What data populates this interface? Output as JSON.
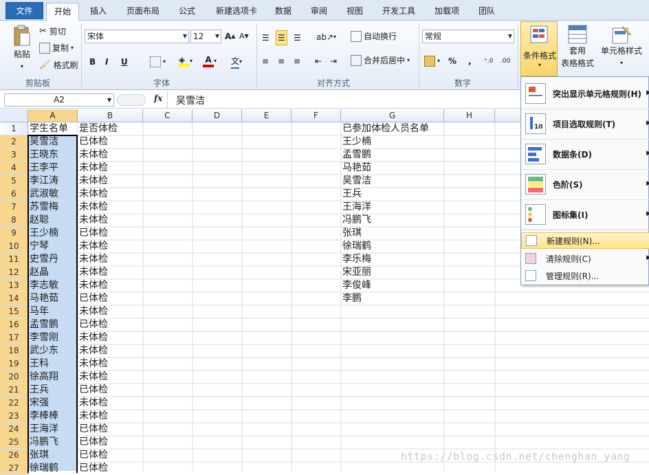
{
  "tabs": [
    {
      "label": "文件"
    },
    {
      "label": "开始"
    },
    {
      "label": "插入"
    },
    {
      "label": "页面布局"
    },
    {
      "label": "公式"
    },
    {
      "label": "新建选项卡"
    },
    {
      "label": "数据"
    },
    {
      "label": "审阅"
    },
    {
      "label": "视图"
    },
    {
      "label": "开发工具"
    },
    {
      "label": "加载项"
    },
    {
      "label": "团队"
    }
  ],
  "ribbon": {
    "paste": "粘贴",
    "cut": "剪切",
    "copy": "复制",
    "painter": "格式刷",
    "clipboard": "剪贴板",
    "font_name": "宋体",
    "font_size": "12",
    "font_group": "字体",
    "wrap": "自动换行",
    "merge": "合并后居中",
    "align_group": "对齐方式",
    "num_format": "常规",
    "number_group": "数字",
    "cond_format": "条件格式",
    "table_format_1": "套用",
    "table_format_2": "表格格式",
    "cell_style": "单元格样式",
    "bold": "B",
    "italic": "I",
    "underline": "U",
    "pct": "%",
    "comma": ","
  },
  "formula": {
    "namebox": "A2",
    "fx": "fx",
    "value": "吴雪洁"
  },
  "columns": [
    "A",
    "B",
    "C",
    "D",
    "E",
    "F",
    "G",
    "H",
    "I"
  ],
  "rows": [
    "1",
    "2",
    "3",
    "4",
    "5",
    "6",
    "7",
    "8",
    "9",
    "10",
    "11",
    "12",
    "13",
    "14",
    "15",
    "16",
    "17",
    "18",
    "19",
    "20",
    "21",
    "22",
    "23",
    "24",
    "25",
    "26",
    "27"
  ],
  "colA": [
    "学生名单",
    "吴雪洁",
    "王晓东",
    "王李平",
    "李江涛",
    "武淑敏",
    "苏雪梅",
    "赵聪",
    "王少楠",
    "宁琴",
    "史雪丹",
    "赵晶",
    "李志敏",
    "马艳茹",
    "马年",
    "孟雪鹏",
    "李雪刚",
    "武少东",
    "王科",
    "徐高翔",
    "王兵",
    "宋强",
    "李棒棒",
    "王海洋",
    "冯鹏飞",
    "张琪",
    "徐瑞鹤"
  ],
  "colB": [
    "是否体检",
    "已体检",
    "未体检",
    "未体检",
    "未体检",
    "未体检",
    "未体检",
    "未体检",
    "已体检",
    "未体检",
    "未体检",
    "未体检",
    "未体检",
    "已体检",
    "未体检",
    "已体检",
    "未体检",
    "未体检",
    "未体检",
    "未体检",
    "已体检",
    "未体检",
    "未体检",
    "已体检",
    "已体检",
    "已体检",
    "已体检"
  ],
  "colG": [
    "已参加体检人员名单",
    "王少楠",
    "孟雪鹏",
    "马艳茹",
    "吴雪洁",
    "王兵",
    "王海洋",
    "冯鹏飞",
    "张琪",
    "徐瑞鹤",
    "李乐梅",
    "宋亚丽",
    "李俊峰",
    "李鹏"
  ],
  "menu": {
    "highlight": "突出显示单元格规则(H)",
    "topbottom": "项目选取规则(T)",
    "databar": "数据条(D)",
    "colorscale": "色阶(S)",
    "iconset": "图标集(I)",
    "newrule": "新建规则(N)...",
    "clear": "清除规则(C)",
    "manage": "管理规则(R)..."
  },
  "watermark": "https://blog.csdn.net/chenghan_yang"
}
